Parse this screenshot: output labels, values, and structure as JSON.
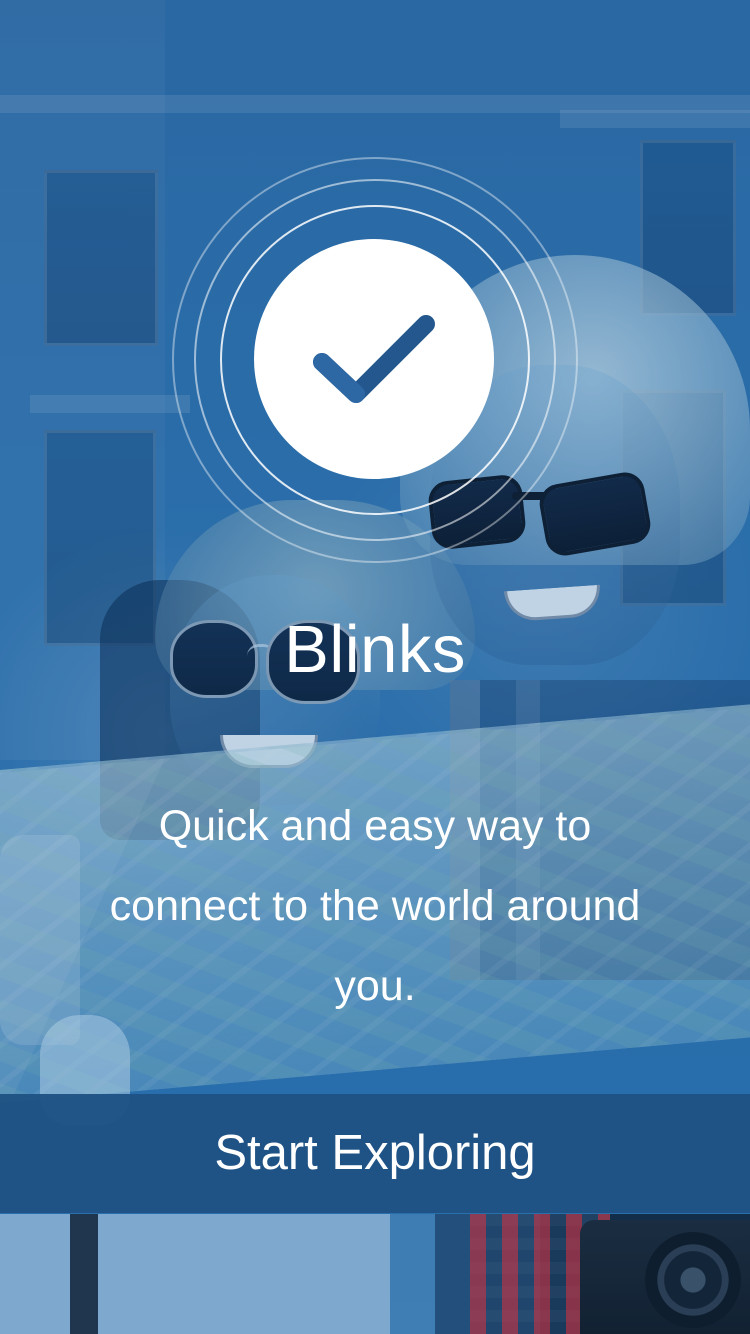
{
  "hero": {
    "app_name": "Blinks",
    "tagline": "Quick and easy way to connect to the world around you.",
    "icon": "check-icon"
  },
  "cta": {
    "label": "Start Exploring"
  },
  "colors": {
    "primary": "#1f5284",
    "overlay_blue": "#2a72b0",
    "white": "#ffffff",
    "check_blue": "#23578d"
  }
}
